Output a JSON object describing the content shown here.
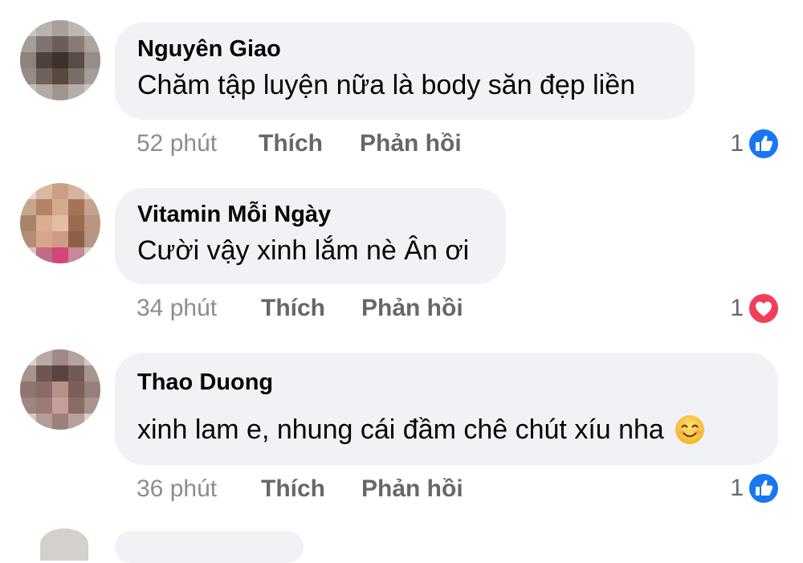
{
  "comments": [
    {
      "author": "Nguyên Giao",
      "text": "Chăm tập luyện nữa là body săn đẹp liền",
      "time": "52 phút",
      "like_label": "Thích",
      "reply_label": "Phản hồi",
      "reaction_count": "1",
      "reaction_icon": "like-icon",
      "reaction_color": "#1877f2"
    },
    {
      "author": "Vitamin Mỗi Ngày",
      "text": "Cười vậy xinh lắm nè Ân ơi",
      "time": "34 phút",
      "like_label": "Thích",
      "reply_label": "Phản hồi",
      "reaction_count": "1",
      "reaction_icon": "love-icon",
      "reaction_color": "#f33e58"
    },
    {
      "author": "Thao Duong",
      "text": "xinh lam e, nhung cái đầm chê chút xíu nha",
      "emoji": "smiling-face-icon",
      "time": "36 phút",
      "like_label": "Thích",
      "reply_label": "Phản hồi",
      "reaction_count": "1",
      "reaction_icon": "like-icon",
      "reaction_color": "#1877f2"
    }
  ],
  "colors": {
    "bubble_bg": "#f0f2f5",
    "meta_text": "#65676b",
    "like_blue": "#1877f2",
    "love_red": "#f33e58"
  }
}
